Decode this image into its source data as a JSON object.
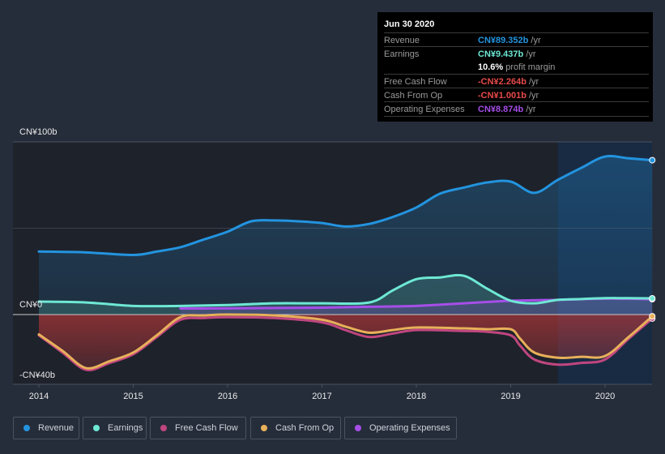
{
  "tooltip": {
    "date": "Jun 30 2020",
    "rows": [
      {
        "label": "Revenue",
        "value": "CN¥89.352b",
        "unit": " /yr",
        "color": "#2394df"
      },
      {
        "label": "Earnings",
        "value": "CN¥9.437b",
        "unit": " /yr",
        "color": "#6ee8d4"
      },
      {
        "label": "",
        "value": "10.6%",
        "unit": " profit margin",
        "color": "#ffffff"
      },
      {
        "label": "Free Cash Flow",
        "value": "-CN¥2.264b",
        "unit": " /yr",
        "color": "#e84a4a"
      },
      {
        "label": "Cash From Op",
        "value": "-CN¥1.001b",
        "unit": " /yr",
        "color": "#e84a4a"
      },
      {
        "label": "Operating Expenses",
        "value": "CN¥8.874b",
        "unit": " /yr",
        "color": "#a64ee8"
      }
    ]
  },
  "legend": [
    {
      "label": "Revenue",
      "color": "#2394df"
    },
    {
      "label": "Earnings",
      "color": "#6ee8d4"
    },
    {
      "label": "Free Cash Flow",
      "color": "#c0467f"
    },
    {
      "label": "Cash From Op",
      "color": "#e8b05a"
    },
    {
      "label": "Operating Expenses",
      "color": "#a64ee8"
    }
  ],
  "chart_data": {
    "type": "area",
    "title": "",
    "xlabel": "",
    "ylabel": "",
    "ylim": [
      -40,
      100
    ],
    "xlim": [
      2013.85,
      2020.5
    ],
    "y_tick_labels": [
      "CN¥100b",
      "CN¥0",
      "-CN¥40b"
    ],
    "y_ticks": [
      100,
      0,
      -40
    ],
    "x_tick_labels": [
      "2014",
      "2015",
      "2016",
      "2017",
      "2018",
      "2019",
      "2020"
    ],
    "x_ticks": [
      2014,
      2015,
      2016,
      2017,
      2018,
      2019,
      2020
    ],
    "grid": true,
    "highlight_start": 2019.5,
    "series": [
      {
        "name": "Revenue",
        "color": "#2394df",
        "x": [
          2014,
          2014.5,
          2015,
          2015.25,
          2015.5,
          2015.75,
          2016,
          2016.25,
          2016.5,
          2016.75,
          2017,
          2017.25,
          2017.5,
          2017.75,
          2018,
          2018.25,
          2018.5,
          2018.75,
          2019,
          2019.25,
          2019.5,
          2019.75,
          2020,
          2020.25,
          2020.5
        ],
        "values": [
          36.5,
          36.0,
          34.5,
          36.5,
          39.0,
          43.5,
          48.0,
          54.0,
          54.5,
          54.0,
          53.0,
          51.0,
          52.5,
          56.5,
          62.0,
          70.0,
          73.5,
          76.5,
          77.0,
          70.5,
          78.0,
          85.0,
          91.5,
          90.5,
          89.4
        ]
      },
      {
        "name": "Earnings",
        "color": "#6ee8d4",
        "x": [
          2014,
          2014.5,
          2015,
          2015.5,
          2016,
          2016.5,
          2017,
          2017.5,
          2017.75,
          2018,
          2018.25,
          2018.5,
          2018.75,
          2019,
          2019.25,
          2019.5,
          2019.75,
          2020,
          2020.25,
          2020.5
        ],
        "values": [
          7.5,
          7.0,
          5.0,
          5.0,
          5.5,
          6.5,
          6.5,
          7.0,
          14.0,
          20.5,
          21.5,
          22.5,
          15.0,
          8.0,
          6.5,
          8.5,
          9.0,
          9.5,
          9.5,
          9.4
        ]
      },
      {
        "name": "Free Cash Flow",
        "color": "#c0467f",
        "x": [
          2014,
          2014.25,
          2014.5,
          2014.75,
          2015,
          2015.25,
          2015.5,
          2015.75,
          2016,
          2016.5,
          2017,
          2017.25,
          2017.5,
          2017.75,
          2018,
          2018.5,
          2018.75,
          2019,
          2019.1,
          2019.25,
          2019.5,
          2019.75,
          2020,
          2020.25,
          2020.5
        ],
        "values": [
          -12.0,
          -22.0,
          -32.0,
          -28.0,
          -23.0,
          -13.0,
          -3.0,
          -2.0,
          -1.5,
          -2.0,
          -4.5,
          -9.0,
          -13.0,
          -11.0,
          -9.0,
          -9.5,
          -10.0,
          -12.0,
          -18.0,
          -26.0,
          -29.0,
          -28.0,
          -26.0,
          -14.0,
          -2.3
        ]
      },
      {
        "name": "Cash From Op",
        "color": "#e8b05a",
        "x": [
          2014,
          2014.25,
          2014.5,
          2014.75,
          2015,
          2015.25,
          2015.5,
          2015.75,
          2016,
          2016.5,
          2017,
          2017.25,
          2017.5,
          2017.75,
          2018,
          2018.5,
          2018.75,
          2019,
          2019.1,
          2019.25,
          2019.5,
          2019.75,
          2020,
          2020.25,
          2020.5
        ],
        "values": [
          -11.5,
          -21.0,
          -31.0,
          -27.0,
          -22.0,
          -12.0,
          -1.5,
          -0.5,
          0.0,
          -0.5,
          -3.0,
          -7.0,
          -10.5,
          -9.0,
          -7.5,
          -8.0,
          -8.5,
          -8.5,
          -14.0,
          -22.0,
          -25.0,
          -24.5,
          -24.0,
          -13.0,
          -1.0
        ]
      },
      {
        "name": "Operating Expenses",
        "color": "#a64ee8",
        "x": [
          2015.5,
          2016,
          2016.5,
          2017,
          2017.5,
          2018,
          2018.5,
          2019,
          2019.5,
          2020,
          2020.5
        ],
        "values": [
          3.5,
          3.6,
          3.8,
          4.0,
          4.5,
          5.0,
          6.5,
          8.0,
          8.5,
          9.2,
          8.9
        ]
      }
    ]
  }
}
